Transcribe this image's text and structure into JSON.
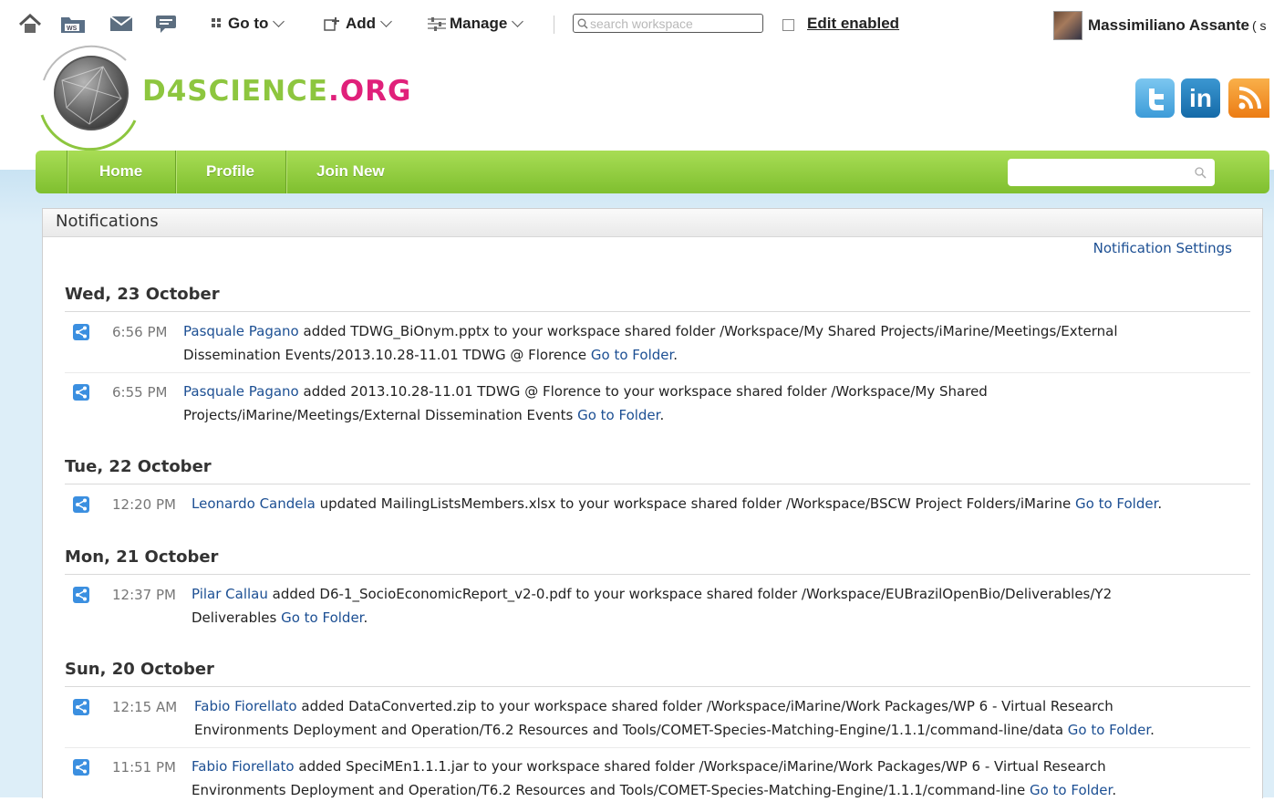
{
  "topbar": {
    "goto_label": "Go to",
    "add_label": "Add",
    "manage_label": "Manage",
    "search_placeholder": "search workspace",
    "edit_label": "Edit enabled",
    "user_name": "Massimiliano Assante",
    "user_extra": "( s"
  },
  "header": {
    "logo_prefix": "D4SCIENCE",
    "logo_suffix": ".ORG",
    "social": [
      {
        "icon": "twitter-icon",
        "glyph": "t",
        "color": "#4aa8e0"
      },
      {
        "icon": "linkedin-icon",
        "glyph": "in",
        "color": "#1a7ab8"
      },
      {
        "icon": "rss-icon",
        "glyph": "rss",
        "color": "#f08a1c"
      }
    ]
  },
  "nav": {
    "items": [
      "Home",
      "Profile",
      "Join New"
    ],
    "search_placeholder": ""
  },
  "panel": {
    "title": "Notifications",
    "settings_link": "Notification Settings"
  },
  "groups": [
    {
      "date": "Wed, 23 October",
      "items": [
        {
          "time": "6:56 PM",
          "user": "Pasquale Pagano",
          "line1": " added TDWG_BiOnym.pptx to your workspace shared folder /Workspace/My Shared Projects/iMarine/Meetings/External",
          "line2": "Dissemination Events/2013.10.28-11.01 TDWG @ Florence ",
          "link": "Go to Folder",
          "end": "."
        },
        {
          "time": "6:55 PM",
          "user": "Pasquale Pagano",
          "line1": " added 2013.10.28-11.01 TDWG @ Florence to your workspace shared folder /Workspace/My Shared",
          "line2": "Projects/iMarine/Meetings/External Dissemination Events ",
          "link": "Go to Folder",
          "end": "."
        }
      ]
    },
    {
      "date": "Tue, 22 October",
      "items": [
        {
          "time": "12:20 PM",
          "user": "Leonardo Candela",
          "line1": " updated MailingListsMembers.xlsx to your workspace shared folder /Workspace/BSCW Project Folders/iMarine ",
          "link": "Go to Folder",
          "end": "."
        }
      ]
    },
    {
      "date": "Mon, 21 October",
      "items": [
        {
          "time": "12:37 PM",
          "user": "Pilar Callau",
          "line1": " added D6-1_SocioEconomicReport_v2-0.pdf to your workspace shared folder /Workspace/EUBrazilOpenBio/Deliverables/Y2",
          "line2": "Deliverables ",
          "link": "Go to Folder",
          "end": "."
        }
      ]
    },
    {
      "date": "Sun, 20 October",
      "items": [
        {
          "time": "12:15 AM",
          "user": "Fabio Fiorellato",
          "line1": " added DataConverted.zip to your workspace shared folder /Workspace/iMarine/Work Packages/WP 6 - Virtual Research",
          "line2": "Environments Deployment and Operation/T6.2 Resources and Tools/COMET-Species-Matching-Engine/1.1.1/command-line/data ",
          "link": "Go to Folder",
          "end": "."
        },
        {
          "time": "11:51 PM",
          "user": "Fabio Fiorellato",
          "line1": " added SpeciMEn1.1.1.jar to your workspace shared folder /Workspace/iMarine/Work Packages/WP 6 - Virtual Research",
          "line2": "Environments Deployment and Operation/T6.2 Resources and Tools/COMET-Species-Matching-Engine/1.1.1/command-line ",
          "link": "Go to Folder",
          "end": "."
        }
      ]
    }
  ]
}
